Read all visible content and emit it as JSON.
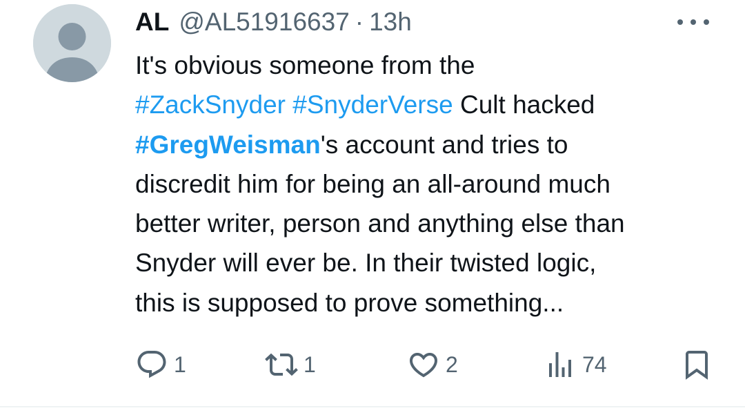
{
  "tweet": {
    "author": {
      "name": "AL",
      "handle": "@AL51916637"
    },
    "separator": "·",
    "time": "13h",
    "text": {
      "line1": "It's obvious someone from the",
      "hashtag1": "#ZackSnyder",
      "hashtag2": "#SnyderVerse",
      "line2_rest": " Cult hacked",
      "hashtag3": "#GregWeisman",
      "line3_rest": "'s account and tries to",
      "line4": "discredit him for being an all-around much",
      "line5": "better writer, person and anything else than",
      "line6": "Snyder will ever be. In their twisted logic,",
      "line7": "this is supposed to prove something..."
    },
    "actions": {
      "replies": "1",
      "retweets": "1",
      "likes": "2",
      "views": "74"
    },
    "icons": {
      "avatar": "default-avatar-icon",
      "more": "more-icon",
      "reply": "reply-icon",
      "retweet": "retweet-icon",
      "like": "heart-icon",
      "views": "analytics-icon",
      "bookmark": "bookmark-icon"
    },
    "colors": {
      "text": "#0f1419",
      "secondary": "#536471",
      "link": "#1d9bf0",
      "avatar_bg": "#cfd9de",
      "avatar_fg": "#8899a6"
    }
  }
}
